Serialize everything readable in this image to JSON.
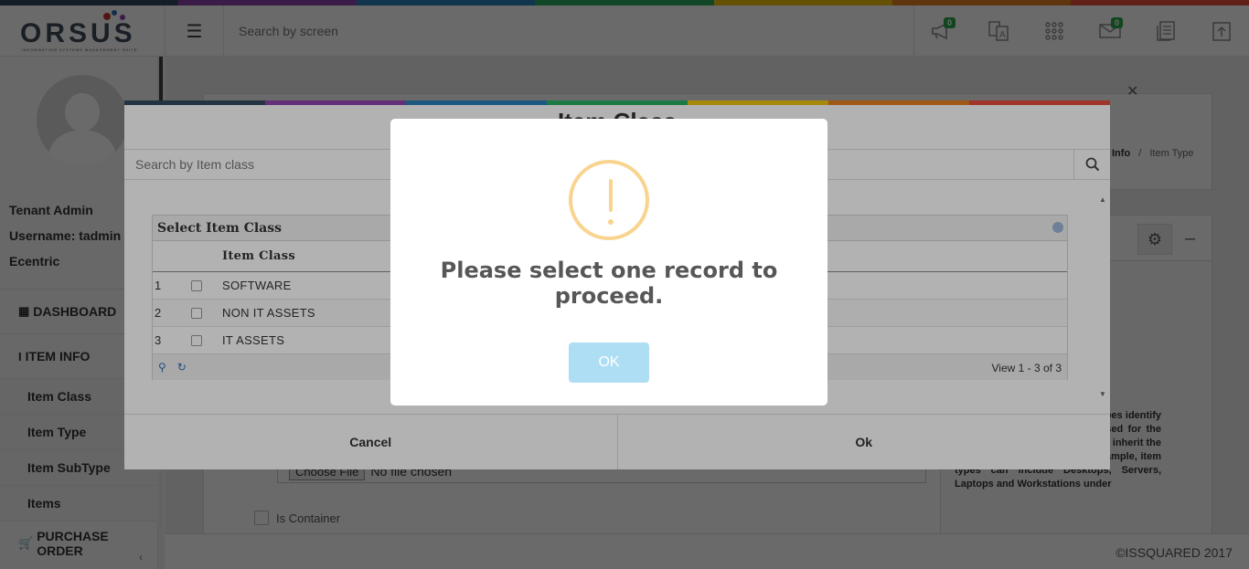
{
  "colors": {
    "rainbow": [
      "#34495e",
      "#8e44ad",
      "#2980b9",
      "#27ae60",
      "#f1c40f",
      "#e67e22",
      "#e74c3c"
    ],
    "alert_icon": "#f8d48f",
    "alert_button": "#aedef4"
  },
  "header": {
    "logo_text": "ORSUS",
    "logo_subtitle": "INFORMATION SYSTEMS MANAGEMENT SUITE",
    "search_placeholder": "Search by screen",
    "icons": [
      {
        "name": "megaphone-icon",
        "badge": "0"
      },
      {
        "name": "translate-icon",
        "badge": ""
      },
      {
        "name": "apps-grid-icon",
        "badge": ""
      },
      {
        "name": "mail-icon",
        "badge": "0"
      },
      {
        "name": "document-icon",
        "badge": ""
      },
      {
        "name": "upload-icon",
        "badge": ""
      }
    ]
  },
  "sidebar": {
    "role": "Tenant Admin",
    "username": "Username: tadmin",
    "company": "Ecentric",
    "menu": {
      "dashboard": "DASHBOARD",
      "item_info": "ITEM INFO",
      "item_class": "Item Class",
      "item_type": "Item Type",
      "item_subtype": "Item SubType",
      "items": "Items",
      "purchase_order": "PURCHASE ORDER"
    }
  },
  "background": {
    "breadcrumb_a": "Info",
    "breadcrumb_sep": "/",
    "breadcrumb_b": "Item Type",
    "file_button": "Choose File",
    "file_status": "No file chosen",
    "is_container": "Is Container",
    "help_text": "resource set, which and item types identify the kinds of assets that are used for the enterprise's operations and they inherit the properties of item class. For example, item types can include Desktops, Servers, Laptops and Workstations under",
    "footer": "©ISSQUARED 2017"
  },
  "modal": {
    "title": "Item Class",
    "search_placeholder": "Search by Item class",
    "grid_caption": "Select Item Class",
    "column_header": "Item Class",
    "rows": [
      {
        "num": "1",
        "name": "SOFTWARE"
      },
      {
        "num": "2",
        "name": "NON IT ASSETS"
      },
      {
        "num": "3",
        "name": "IT ASSETS"
      }
    ],
    "pager_text": "View 1 - 3 of 3",
    "cancel_label": "Cancel",
    "ok_label": "Ok"
  },
  "alert": {
    "message": "Please select one record to proceed.",
    "button": "OK"
  }
}
